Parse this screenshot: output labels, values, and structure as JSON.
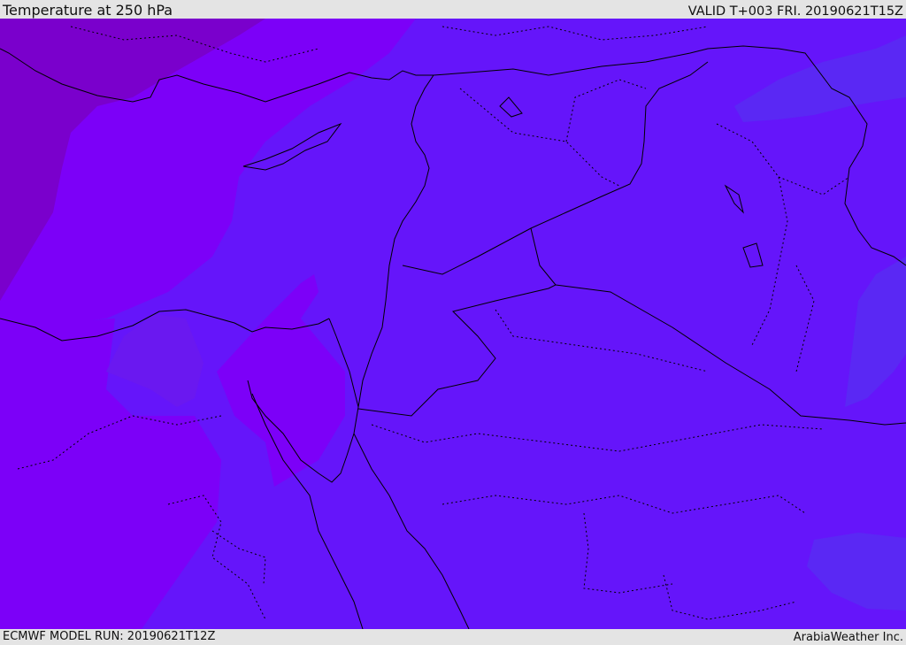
{
  "header": {
    "title": "Temperature at 250 hPa",
    "valid_time": "VALID T+003 FRI. 20190621T15Z"
  },
  "footer": {
    "model_run": "ECMWF MODEL RUN: 20190621T12Z",
    "credit": "ArabiaWeather Inc."
  },
  "colors": {
    "background_band": "#e4e4e4",
    "coldest_band": "#7a00cc",
    "cold_band": "#7c00f8",
    "mid_band": "#6515fa",
    "warm_band": "#5a28f4",
    "border_line": "#000000"
  }
}
